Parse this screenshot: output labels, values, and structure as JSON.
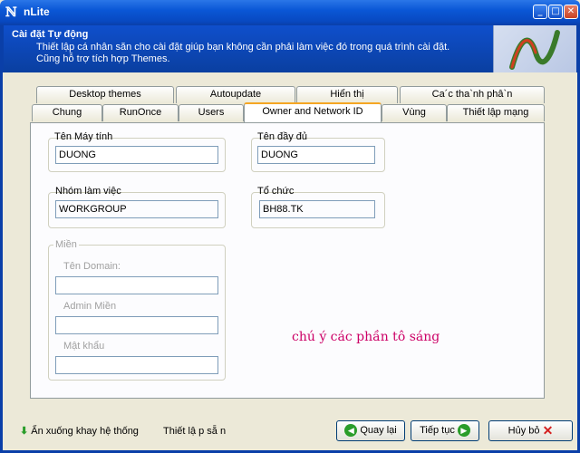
{
  "window": {
    "icon": "nlite-icon",
    "title": "nLite",
    "controls": [
      "minimize-icon",
      "maximize-icon",
      "close-icon"
    ]
  },
  "header": {
    "title": "Cài đặt Tự động",
    "desc_line1": "Thiết lập cá nhân săn cho cài đặt giúp bạn không cần phải làm việc đó trong quá trình cài đặt.",
    "desc_line2": "Cũng hỗ trợ tích hợp Themes."
  },
  "tabs_row1": [
    "Desktop themes",
    "Autoupdate",
    "Hiển thị",
    "Ca´c tha`nh phâ`n"
  ],
  "tabs_row2": [
    "Chung",
    "RunOnce",
    "Users",
    "Owner and Network ID",
    "Vùng",
    "Thiết lập mạng"
  ],
  "active_tab": "Owner and Network ID",
  "form": {
    "computer_name_label": "Tên Máy tính",
    "computer_name_value": "DUONG",
    "full_name_label": "Tên đầy đủ",
    "full_name_value": "DUONG",
    "workgroup_label": "Nhóm làm việc",
    "workgroup_value": "WORKGROUP",
    "org_label": "Tổ chức",
    "org_value": "BH88.TK",
    "domain_group_label": "Miền",
    "domain_name_label": "Tên Domain:",
    "domain_name_value": "",
    "admin_domain_label": "Admin Miền",
    "admin_domain_value": "",
    "password_label": "Mật khẩu",
    "password_value": ""
  },
  "note": "chú ý các phần tô sáng",
  "bottom": {
    "hide_tray_label": "Ẩn xuống khay hệ thống",
    "presets_label": "Thiết lậ p sẵ n",
    "back_label": "Quay lại",
    "next_label": "Tiếp tục",
    "cancel_label": "Hủy bỏ"
  },
  "colors": {
    "titlebar": "#0a57d6",
    "highlight": "#ffff2e",
    "note": "#cc0066"
  }
}
